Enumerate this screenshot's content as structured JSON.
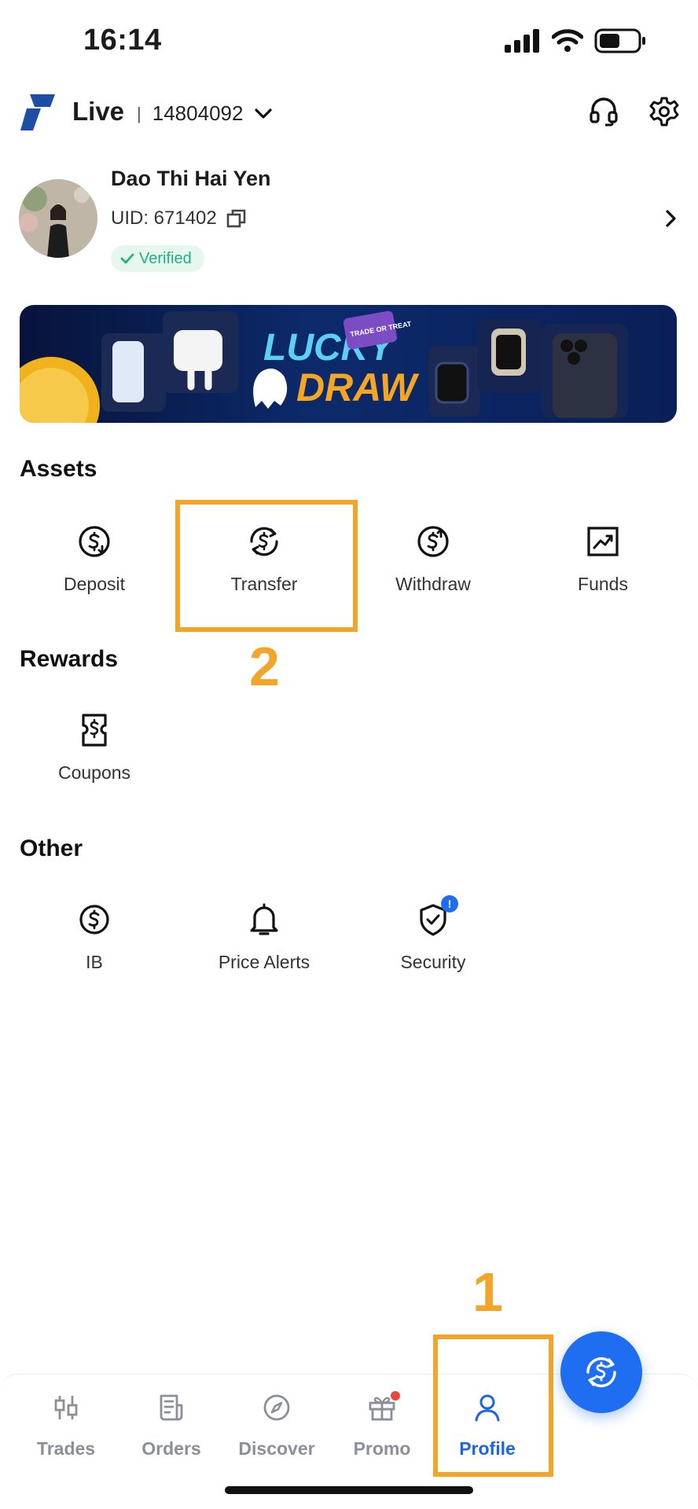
{
  "status_bar": {
    "time": "16:14",
    "battery_level": 0.55
  },
  "header": {
    "account_type": "Live",
    "separator": "|",
    "account_number": "14804092"
  },
  "profile": {
    "name": "Dao Thi Hai Yen",
    "uid": "UID: 671402",
    "verified_label": "Verified"
  },
  "banner": {
    "line1": "LUCKY",
    "tag": "TRADE OR TREAT",
    "line2": "DRAW"
  },
  "assets": {
    "title": "Assets",
    "items": [
      {
        "label": "Deposit",
        "icon": "deposit-icon"
      },
      {
        "label": "Transfer",
        "icon": "transfer-icon"
      },
      {
        "label": "Withdraw",
        "icon": "withdraw-icon"
      },
      {
        "label": "Funds",
        "icon": "funds-chart-icon"
      }
    ]
  },
  "rewards": {
    "title": "Rewards",
    "items": [
      {
        "label": "Coupons",
        "icon": "coupon-icon"
      }
    ]
  },
  "other": {
    "title": "Other",
    "items": [
      {
        "label": "IB",
        "icon": "ib-icon"
      },
      {
        "label": "Price Alerts",
        "icon": "bell-icon"
      },
      {
        "label": "Security",
        "icon": "shield-icon",
        "badge": "!"
      }
    ]
  },
  "annotations": {
    "step1": "1",
    "step2": "2",
    "color": "#f3a52a"
  },
  "bottom_nav": {
    "items": [
      {
        "label": "Trades",
        "icon": "candlestick-icon"
      },
      {
        "label": "Orders",
        "icon": "orders-icon"
      },
      {
        "label": "Discover",
        "icon": "compass-icon"
      },
      {
        "label": "Promo",
        "icon": "gift-icon"
      },
      {
        "label": "Profile",
        "icon": "person-icon",
        "active": true
      }
    ],
    "active_color": "#1a66e0",
    "inactive_color": "#8a8f98"
  }
}
